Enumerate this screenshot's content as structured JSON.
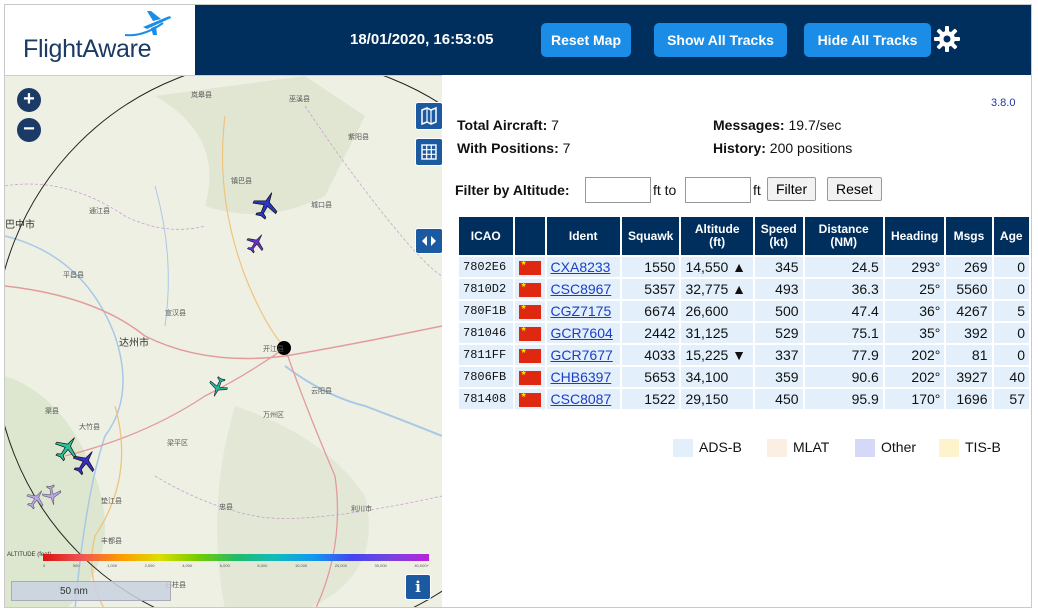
{
  "brand": {
    "name": "FlightAware"
  },
  "header": {
    "datetime": "18/01/2020, 16:53:05",
    "reset_map": "Reset Map",
    "show_all_tracks": "Show All Tracks",
    "hide_all_tracks": "Hide All Tracks"
  },
  "map": {
    "zoom_in": "+",
    "zoom_out": "−",
    "scale_label": "50 nm",
    "altitude_legend_title": "ALTITUDE (feet)",
    "altitude_ticks": [
      "0",
      "500",
      "1,000",
      "2,000",
      "4,000",
      "6,000",
      "8,000",
      "10,000",
      "20,000",
      "30,000",
      "40,000+"
    ],
    "places": [
      "达州市",
      "万州区",
      "云阳县",
      "开江县",
      "宣汉县",
      "城口县",
      "巫溪县",
      "平昌县",
      "大竹县",
      "梁平区",
      "垫江县",
      "忠县",
      "利川市",
      "巴中市",
      "通江县",
      "镇巴县",
      "紫阳县",
      "岚皋县",
      "渠县",
      "丰都县",
      "石柱县"
    ],
    "info_button": "i"
  },
  "version": "3.8.0",
  "stats": {
    "total_aircraft_label": "Total Aircraft:",
    "total_aircraft": "7",
    "with_positions_label": "With Positions:",
    "with_positions": "7",
    "messages_label": "Messages:",
    "messages": "19.7/sec",
    "history_label": "History:",
    "history": "200 positions"
  },
  "filter": {
    "label": "Filter by Altitude:",
    "ft_to": "ft to",
    "ft": "ft",
    "filter_button": "Filter",
    "reset_button": "Reset"
  },
  "table": {
    "headers": {
      "icao": "ICAO",
      "ident": "Ident",
      "squawk": "Squawk",
      "altitude": "Altitude (ft)",
      "speed": "Speed (kt)",
      "distance": "Distance (NM)",
      "heading": "Heading",
      "msgs": "Msgs",
      "age": "Age"
    },
    "rows": [
      {
        "icao": "7802E6",
        "ident": "CXA8233",
        "squawk": "1550",
        "altitude": "14,550 ▲",
        "speed": "345",
        "distance": "24.5",
        "heading": "293°",
        "msgs": "269",
        "age": "0"
      },
      {
        "icao": "7810D2",
        "ident": "CSC8967",
        "squawk": "5357",
        "altitude": "32,775 ▲",
        "speed": "493",
        "distance": "36.3",
        "heading": "25°",
        "msgs": "5560",
        "age": "0"
      },
      {
        "icao": "780F1B",
        "ident": "CGZ7175",
        "squawk": "6674",
        "altitude": "26,600",
        "speed": "500",
        "distance": "47.4",
        "heading": "36°",
        "msgs": "4267",
        "age": "5"
      },
      {
        "icao": "781046",
        "ident": "GCR7604",
        "squawk": "2442",
        "altitude": "31,125",
        "speed": "529",
        "distance": "75.1",
        "heading": "35°",
        "msgs": "392",
        "age": "0"
      },
      {
        "icao": "7811FF",
        "ident": "GCR7677",
        "squawk": "4033",
        "altitude": "15,225 ▼",
        "speed": "337",
        "distance": "77.9",
        "heading": "202°",
        "msgs": "81",
        "age": "0"
      },
      {
        "icao": "7806FB",
        "ident": "CHB6397",
        "squawk": "5653",
        "altitude": "34,100",
        "speed": "359",
        "distance": "90.6",
        "heading": "202°",
        "msgs": "3927",
        "age": "40"
      },
      {
        "icao": "781408",
        "ident": "CSC8087",
        "squawk": "1522",
        "altitude": "29,150",
        "speed": "450",
        "distance": "95.9",
        "heading": "170°",
        "msgs": "1696",
        "age": "57"
      }
    ]
  },
  "legend": [
    {
      "label": "ADS-B",
      "color": "#e3f0fb"
    },
    {
      "label": "MLAT",
      "color": "#fbeee3"
    },
    {
      "label": "Other",
      "color": "#d5d8f7"
    },
    {
      "label": "TIS-B",
      "color": "#fdf3cc"
    }
  ],
  "colors": {
    "header_bg": "#002f5d",
    "button_bg": "#1b8de6",
    "link": "#1a3ec7"
  }
}
